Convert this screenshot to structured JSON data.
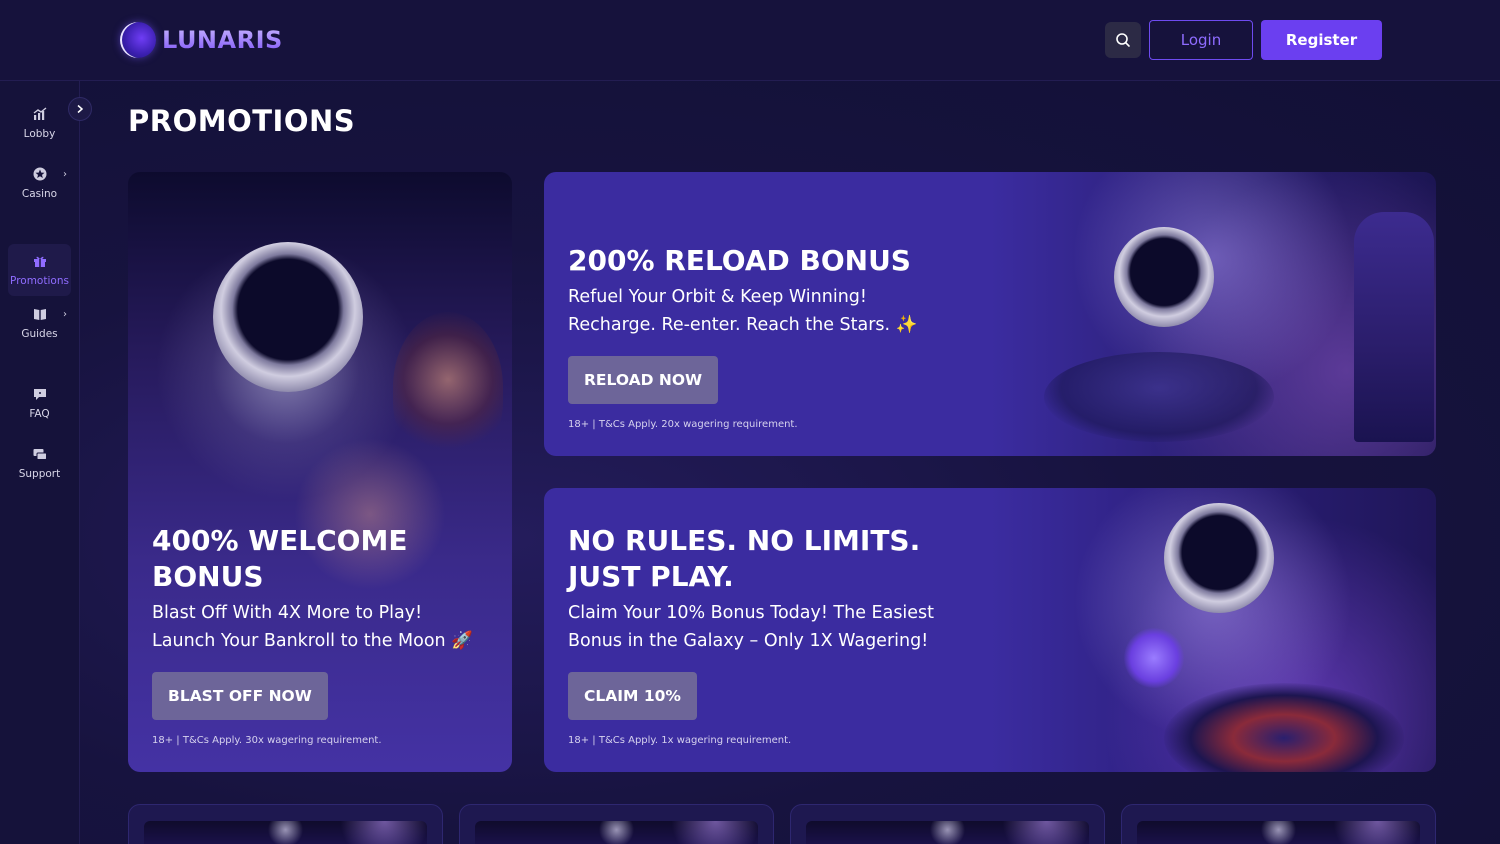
{
  "header": {
    "logo_text": "LUNARIS",
    "login_label": "Login",
    "register_label": "Register",
    "search_icon": "search-icon"
  },
  "sidebar": {
    "items": [
      {
        "label": "Lobby",
        "icon": "chart-icon",
        "has_caret": false
      },
      {
        "label": "Casino",
        "icon": "casino-chip-icon",
        "has_caret": true
      },
      {
        "label": "Promotions",
        "icon": "gift-icon",
        "has_caret": false,
        "active": true
      },
      {
        "label": "Guides",
        "icon": "book-icon",
        "has_caret": true
      },
      {
        "label": "FAQ",
        "icon": "chat-icon",
        "has_caret": false
      },
      {
        "label": "Support",
        "icon": "support-icon",
        "has_caret": false
      }
    ],
    "caret": "›"
  },
  "main": {
    "title": "PROMOTIONS",
    "promos": [
      {
        "title": "400% WELCOME BONUS",
        "subtitle": "Blast Off With 4X More to Play!\nLaunch Your Bankroll to the Moon 🚀",
        "button": "BLAST OFF NOW",
        "terms": "18+ | T&Cs Apply. 30x wagering requirement."
      },
      {
        "title": "200% RELOAD BONUS",
        "subtitle": "Refuel Your Orbit & Keep Winning!\nRecharge. Re-enter. Reach the Stars. ✨",
        "button": "RELOAD NOW",
        "terms": "18+ | T&Cs Apply. 20x wagering requirement."
      },
      {
        "title": "NO RULES. NO LIMITS. JUST PLAY.",
        "subtitle": "Claim Your 10% Bonus Today! The Easiest\nBonus in the Galaxy – Only 1X Wagering!",
        "button": "CLAIM 10%",
        "terms": "18+ | T&Cs Apply. 1x wagering requirement."
      }
    ]
  },
  "colors": {
    "accent": "#6b3ff0",
    "background": "#13103a",
    "card_button": "#6d6599"
  }
}
